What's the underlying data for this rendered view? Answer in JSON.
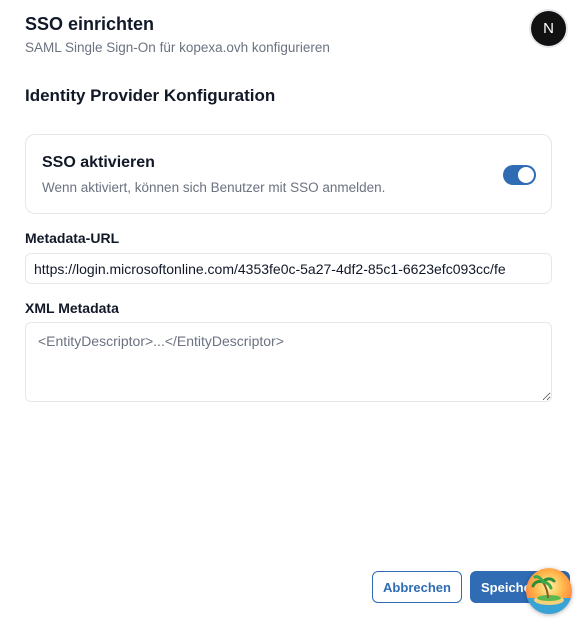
{
  "dialog": {
    "title": "SSO einrichten",
    "subtitle": "SAML Single Sign-On für kopexa.ovh konfigurieren",
    "avatar_initial": "N"
  },
  "section": {
    "title": "Identity Provider Konfiguration"
  },
  "sso_toggle": {
    "title": "SSO aktivieren",
    "description": "Wenn aktiviert, können sich Benutzer mit SSO anmelden.",
    "enabled": true,
    "accent": "#2f6cb3"
  },
  "metadata_url": {
    "label": "Metadata-URL",
    "value": "https://login.microsoftonline.com/4353fe0c-5a27-4df2-85c1-6623efc093cc/fe"
  },
  "xml_metadata": {
    "label": "XML Metadata",
    "placeholder": "<EntityDescriptor>...</EntityDescriptor>",
    "value": ""
  },
  "actions": {
    "cancel_label": "Abbrechen",
    "save_label": "Speichern"
  }
}
